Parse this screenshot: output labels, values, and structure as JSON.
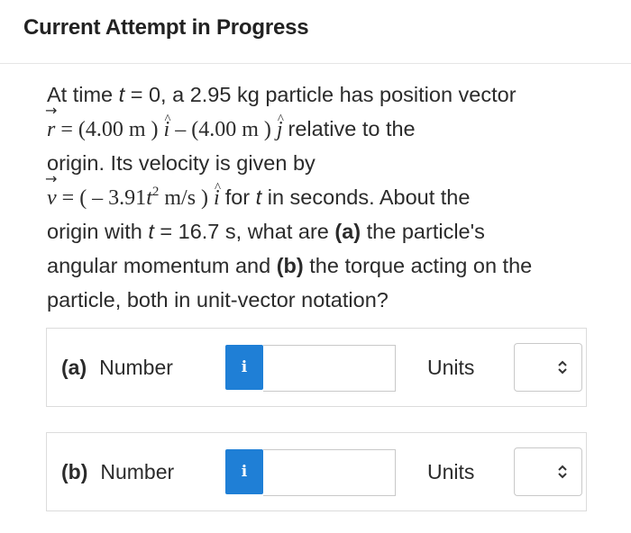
{
  "header": {
    "title": "Current Attempt in Progress"
  },
  "question": {
    "line1_text": "At time ",
    "line1_var": "t",
    "line1_rest": " = 0, a 2.95 kg particle has position vector",
    "r_symbol": "r",
    "r_expr_a": " = (4.00 m ) ",
    "i_symbol": "i",
    "r_expr_b": " – (4.00 m ) ",
    "j_symbol": "j",
    "r_tail": " relative to the",
    "line3": "origin. Its velocity is given by",
    "v_symbol": "v",
    "v_expr_a": " = ( – 3.91",
    "v_var": "t",
    "v_exp": "2",
    "v_expr_b": " m/s ) ",
    "v_tail_a": " for ",
    "v_tail_var": "t",
    "v_tail_b": " in seconds. About the",
    "line5_a": "origin with ",
    "line5_var": "t",
    "line5_b": " = 16.7 s, what are ",
    "part_a": "(a)",
    "line5_c": " the particle's",
    "line6_a": "angular momentum and ",
    "part_b": "(b)",
    "line6_b": " the torque acting on the",
    "line7": "particle, both in unit-vector notation?"
  },
  "answers": [
    {
      "part": "(a)",
      "label": "Number",
      "info": "i",
      "value": "",
      "units_label": "Units",
      "units_value": ""
    },
    {
      "part": "(b)",
      "label": "Number",
      "info": "i",
      "value": "",
      "units_label": "Units",
      "units_value": ""
    }
  ],
  "icons": {
    "info": "info-icon",
    "select": "chevron-up-down-icon"
  },
  "colors": {
    "info_button": "#1f7fd6"
  }
}
